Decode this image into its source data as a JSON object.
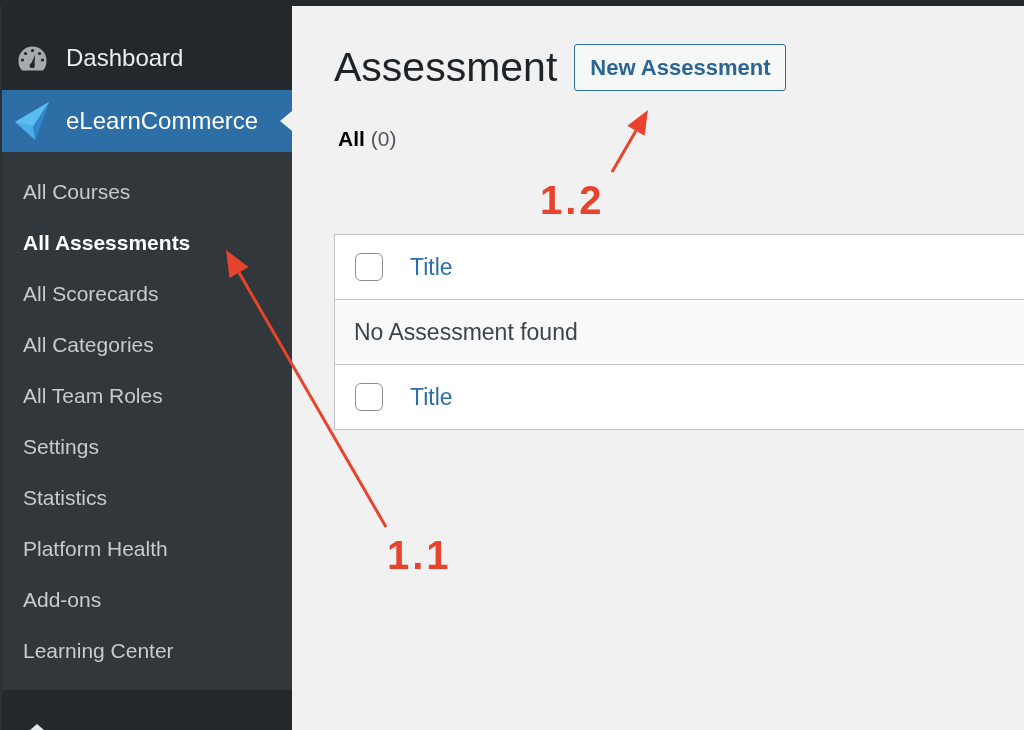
{
  "sidebar": {
    "menu": [
      {
        "label": "Dashboard",
        "selected": false
      },
      {
        "label": "eLearnCommerce",
        "selected": true
      }
    ],
    "submenu": [
      {
        "label": "All Courses",
        "selected": false
      },
      {
        "label": "All Assessments",
        "selected": true
      },
      {
        "label": "All Scorecards",
        "selected": false
      },
      {
        "label": "All Categories",
        "selected": false
      },
      {
        "label": "All Team Roles",
        "selected": false
      },
      {
        "label": "Settings",
        "selected": false
      },
      {
        "label": "Statistics",
        "selected": false
      },
      {
        "label": "Platform Health",
        "selected": false
      },
      {
        "label": "Add-ons",
        "selected": false
      },
      {
        "label": "Learning Center",
        "selected": false
      }
    ]
  },
  "page": {
    "title": "Assessment",
    "new_button": "New Assessment",
    "filters": [
      {
        "label": "All",
        "count": "(0)",
        "selected": true
      }
    ]
  },
  "table": {
    "header": {
      "checked": false,
      "column": "Title"
    },
    "empty_message": "No Assessment found",
    "footer": {
      "checked": false,
      "column": "Title"
    }
  },
  "annotations": [
    {
      "label": "1.1"
    },
    {
      "label": "1.2"
    }
  ]
}
